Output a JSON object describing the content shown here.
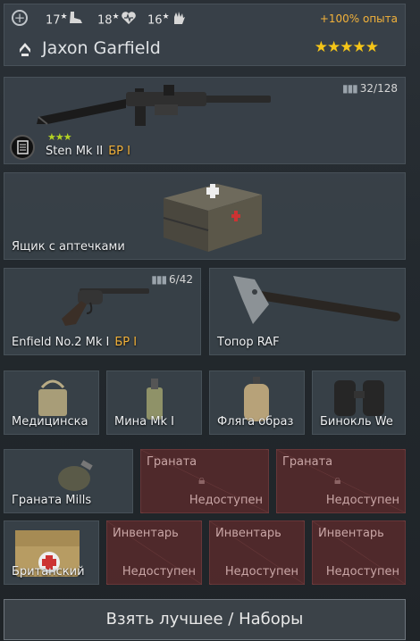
{
  "header": {
    "stats": [
      {
        "value": "17",
        "icon": "boot-icon"
      },
      {
        "value": "18",
        "icon": "heart-icon"
      },
      {
        "value": "16",
        "icon": "hand-icon"
      }
    ],
    "exp_bonus": "+100% опыта",
    "soldier_name": "Jaxon Garfield",
    "rating_stars": 5
  },
  "primary": {
    "name": "Sten Mk II",
    "br": "БР I",
    "ammo": "32/128",
    "tier_stars": 3
  },
  "medkit_crate": {
    "name": "Ящик с аптечками"
  },
  "secondary": {
    "name": "Enfield No.2 Mk I",
    "br": "БР I",
    "ammo": "6/42"
  },
  "melee": {
    "name": "Топор RAF"
  },
  "equipment": [
    {
      "name": "Медицинска"
    },
    {
      "name": "Мина Mk I"
    },
    {
      "name": "Фляга образ"
    },
    {
      "name": "Бинокль We"
    }
  ],
  "grenades": {
    "item": "Граната Mills",
    "locked": [
      {
        "title": "Граната",
        "status": "Недоступен"
      },
      {
        "title": "Граната",
        "status": "Недоступен"
      }
    ]
  },
  "inventory": {
    "item": "Британский",
    "locked": [
      {
        "title": "Инвентарь",
        "status": "Недоступен"
      },
      {
        "title": "Инвентарь",
        "status": "Недоступен"
      },
      {
        "title": "Инвентарь",
        "status": "Недоступен"
      }
    ]
  },
  "bottom_button": "Взять лучшее / Наборы",
  "colors": {
    "br": "#f3b23a",
    "exp": "#f3b23a",
    "star": "#f5c518",
    "tier_star": "#b4d223"
  }
}
